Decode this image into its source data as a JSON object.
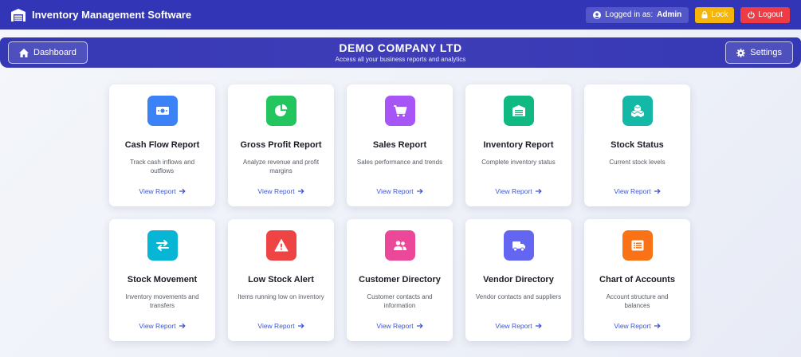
{
  "app": {
    "title": "Inventory Management Software",
    "logged_in_prefix": "Logged in as:",
    "user": "Admin",
    "lock_label": "Lock",
    "logout_label": "Logout"
  },
  "header": {
    "company": "DEMO COMPANY LTD",
    "subtitle": "Access all your business reports and analytics",
    "dashboard_label": "Dashboard",
    "settings_label": "Settings"
  },
  "colors": {
    "topbar": "#3135b6",
    "link": "#3c56d8"
  },
  "cards": [
    {
      "title": "Cash Flow Report",
      "desc": "Track cash inflows and outflows",
      "link": "View Report",
      "icon": "money-bill-icon",
      "color": "#3b82f6"
    },
    {
      "title": "Gross Profit Report",
      "desc": "Analyze revenue and profit margins",
      "link": "View Report",
      "icon": "pie-chart-icon",
      "color": "#22c55e"
    },
    {
      "title": "Sales Report",
      "desc": "Sales performance and trends",
      "link": "View Report",
      "icon": "shopping-cart-icon",
      "color": "#a855f7"
    },
    {
      "title": "Inventory Report",
      "desc": "Complete inventory status",
      "link": "View Report",
      "icon": "warehouse-icon",
      "color": "#10b981"
    },
    {
      "title": "Stock Status",
      "desc": "Current stock levels",
      "link": "View Report",
      "icon": "cubes-icon",
      "color": "#14b8a6"
    },
    {
      "title": "Stock Movement",
      "desc": "Inventory movements and transfers",
      "link": "View Report",
      "icon": "exchange-arrows-icon",
      "color": "#06b6d4"
    },
    {
      "title": "Low Stock Alert",
      "desc": "Items running low on inventory",
      "link": "View Report",
      "icon": "warning-triangle-icon",
      "color": "#ef4444"
    },
    {
      "title": "Customer Directory",
      "desc": "Customer contacts and information",
      "link": "View Report",
      "icon": "users-icon",
      "color": "#ec4899"
    },
    {
      "title": "Vendor Directory",
      "desc": "Vendor contacts and suppliers",
      "link": "View Report",
      "icon": "truck-icon",
      "color": "#6366f1"
    },
    {
      "title": "Chart of Accounts",
      "desc": "Account structure and balances",
      "link": "View Report",
      "icon": "list-alt-icon",
      "color": "#f97316"
    }
  ]
}
